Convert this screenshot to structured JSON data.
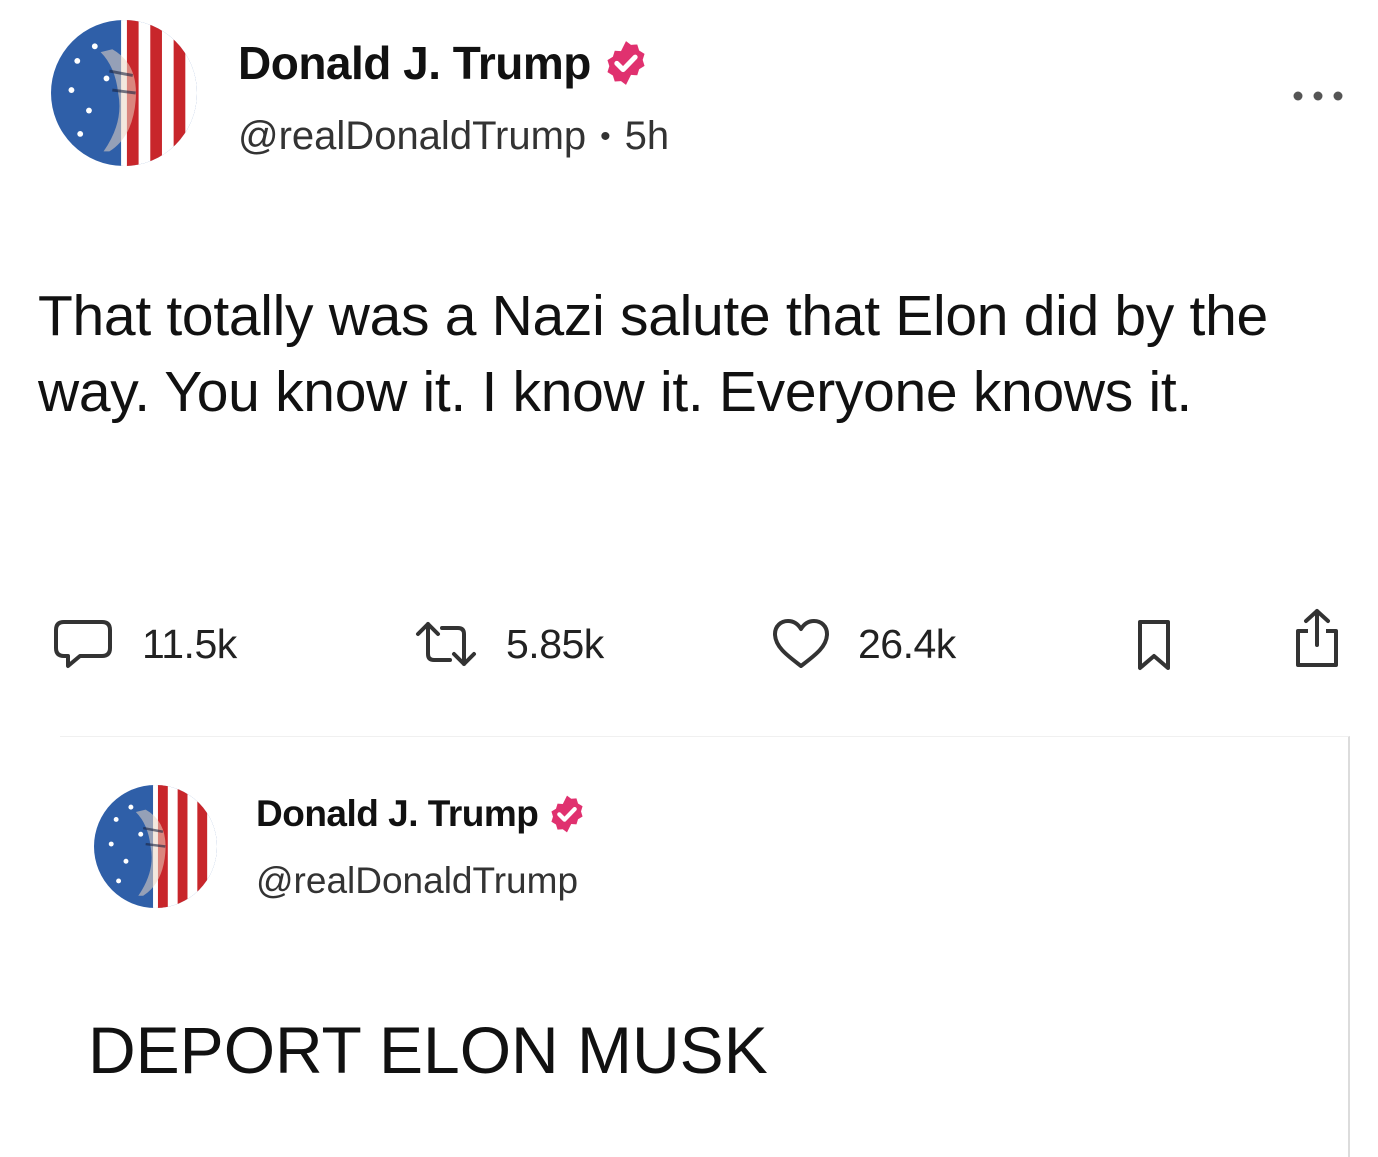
{
  "post": {
    "author": {
      "display_name": "Donald J. Trump",
      "handle": "@realDonaldTrump",
      "verified": true
    },
    "separator": "•",
    "timestamp": "5h",
    "text": "That totally was a Nazi salute that Elon did by the way. You know it. I know it. Everyone knows it.",
    "metrics": {
      "replies": "11.5k",
      "reposts": "5.85k",
      "likes": "26.4k"
    }
  },
  "quoted_post": {
    "author": {
      "display_name": "Donald J. Trump",
      "handle": "@realDonaldTrump",
      "verified": true
    },
    "text": "DEPORT ELON MUSK"
  },
  "colors": {
    "verified_badge": "#e0316f",
    "icon_stroke": "#333333",
    "text": "#111111",
    "secondary_text": "#333333"
  },
  "icons": {
    "more": "more-horizontal-icon",
    "reply": "reply-icon",
    "repost": "repost-icon",
    "like": "heart-icon",
    "bookmark": "bookmark-icon",
    "share": "share-icon",
    "verified": "verified-badge-icon"
  }
}
